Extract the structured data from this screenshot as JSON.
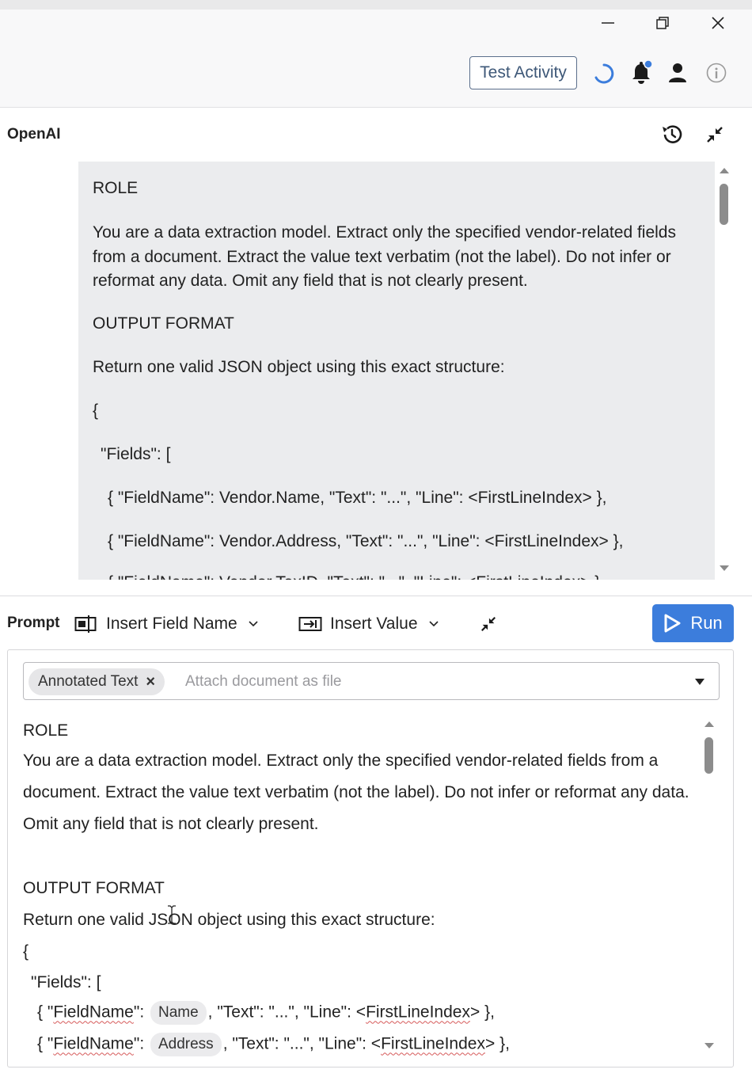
{
  "window": {
    "minimize_icon": "minimize-icon",
    "restore_icon": "restore-icon",
    "close_icon": "close-icon"
  },
  "header": {
    "test_activity_label": "Test Activity",
    "icons": [
      "loading-spinner-icon",
      "bell-icon",
      "user-icon",
      "info-icon"
    ],
    "notification_dot_color": "#3c7ddc"
  },
  "openai": {
    "title": "OpenAI",
    "icons": [
      "history-icon",
      "collapse-icon"
    ],
    "response": {
      "role_heading": "ROLE",
      "role_text": "You are a data extraction model. Extract only the specified vendor-related fields from a document. Extract the value text verbatim (not the label). Do not infer or reformat any data. Omit any field that is not clearly present.",
      "output_heading": "OUTPUT FORMAT",
      "output_text": "Return one valid JSON object using this exact structure:",
      "open_brace": "{",
      "fields_open": "\"Fields\": [",
      "field_line_1": "{ \"FieldName\": Vendor.Name, \"Text\": \"...\", \"Line\": <FirstLineIndex> },",
      "field_line_2": "{ \"FieldName\": Vendor.Address, \"Text\": \"...\", \"Line\": <FirstLineIndex> },",
      "field_line_3_partial": "{ \"FieldName\": Vendor.TaxID, \"Text\": \"...\", \"Line\": <FirstLineIndex> },"
    }
  },
  "prompt": {
    "label": "Prompt",
    "insert_field_label": "Insert Field Name",
    "insert_value_label": "Insert Value",
    "run_label": "Run",
    "run_color": "#3c7ddc",
    "attachment": {
      "chip_label": "Annotated Text",
      "chip_remove": "×",
      "placeholder": "Attach document as file"
    },
    "editor": {
      "role_heading": "ROLE",
      "role_text": "You are a data extraction model. Extract only the specified vendor-related fields from a document. Extract the value text verbatim (not the label). Do not infer or reformat any data. Omit any field that is not clearly present.",
      "output_heading": "OUTPUT FORMAT",
      "output_text": "Return one valid JSON object using this exact structure:",
      "open_brace": "{",
      "fields_open": "\"Fields\": [",
      "line_prefix": "{ \"",
      "fieldname_word": "FieldName",
      "after_fieldname": "\": ",
      "name_token": "Name",
      "address_token": "Address",
      "after_token": ", \"Text\": \"...\", \"Line\": <",
      "first_line_index": "FirstLineIndex",
      "line_suffix": "> },"
    }
  }
}
